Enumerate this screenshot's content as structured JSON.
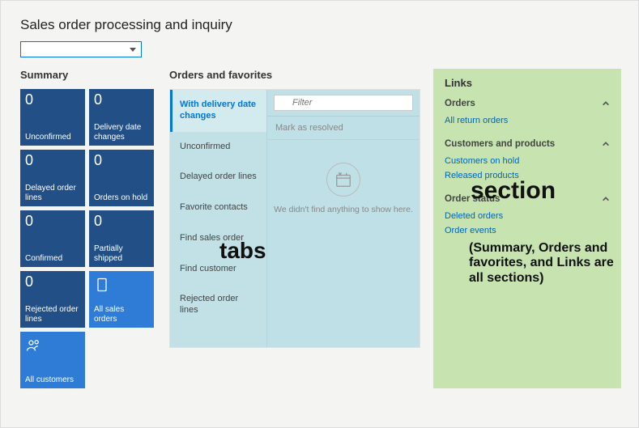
{
  "page_title": "Sales order processing and inquiry",
  "dropdown_value": "",
  "summary": {
    "heading": "Summary",
    "tiles": [
      {
        "count": "0",
        "label": "Unconfirmed"
      },
      {
        "count": "0",
        "label": "Delivery date changes"
      },
      {
        "count": "0",
        "label": "Delayed order lines"
      },
      {
        "count": "0",
        "label": "Orders on hold"
      },
      {
        "count": "0",
        "label": "Confirmed"
      },
      {
        "count": "0",
        "label": "Partially shipped"
      },
      {
        "count": "0",
        "label": "Rejected order lines"
      },
      {
        "count": "",
        "label": "All sales orders",
        "icon": "document",
        "variant": "blue"
      },
      {
        "count": "",
        "label": "All customers",
        "icon": "people",
        "variant": "blue"
      }
    ]
  },
  "orders": {
    "heading": "Orders and favorites",
    "tabs": [
      "With delivery date changes",
      "Unconfirmed",
      "Delayed order lines",
      "Favorite contacts",
      "Find sales order",
      "Find customer",
      "Rejected order lines"
    ],
    "active_tab_index": 0,
    "filter_placeholder": "Filter",
    "mark_resolved": "Mark as resolved",
    "empty_text": "We didn't find anything to show here."
  },
  "links": {
    "heading": "Links",
    "groups": [
      {
        "title": "Orders",
        "items": [
          "All return orders"
        ]
      },
      {
        "title": "Customers and products",
        "items": [
          "Customers on hold",
          "Released products"
        ]
      },
      {
        "title": "Order status",
        "items": [
          "Deleted orders",
          "Order events"
        ]
      }
    ]
  },
  "annotations": {
    "tabs": "tabs",
    "section": "section",
    "caption": "(Summary, Orders and favorites, and Links are all sections)"
  }
}
